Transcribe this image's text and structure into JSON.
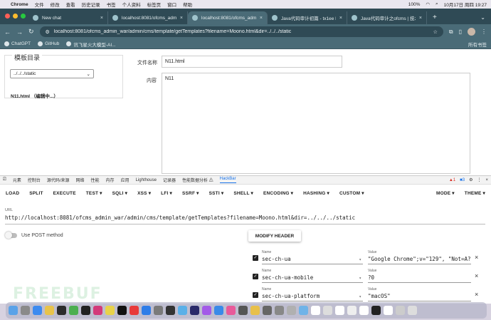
{
  "menubar": {
    "app": "Chrome",
    "items": [
      "文件",
      "修改",
      "查看",
      "历史记录",
      "书签",
      "个人资料",
      "标签页",
      "窗口",
      "帮助"
    ],
    "battery": "100%",
    "datetime": "10月17日 周四 19:27"
  },
  "tabs": [
    {
      "title": "New chat",
      "active": false
    },
    {
      "title": "localhost:8081/ofcms_admin",
      "active": false
    },
    {
      "title": "localhost:8081/ofcms_admin",
      "active": true
    },
    {
      "title": "Java代码审计初篇 - tx1ee blog",
      "active": false
    },
    {
      "title": "Java代码审计之ofcms | 技术…",
      "active": false
    }
  ],
  "toolbar": {
    "url": "localhost:8081/ofcms_admin_war/admin/cms/template/getTemplates?filename=Moono.html&dir=../../../static"
  },
  "bookmarks": {
    "items": [
      "ChatGPT",
      "GitHub",
      "讯飞星火大模型-AI..."
    ],
    "all": "所有书签"
  },
  "page": {
    "panel_title": "模板目录",
    "dir_select": "../../../static",
    "file_item": "N11.html （编辑中...）",
    "filename_label": "文件名称",
    "filename_value": "N11.html",
    "content_label": "内容",
    "content_value": "N11"
  },
  "devtools": {
    "tabs": [
      "元素",
      "控制台",
      "源代码/来源",
      "网络",
      "性能",
      "内存",
      "应用",
      "Lighthouse",
      "记录器",
      "性能数据分析 ⚠",
      "HackBar"
    ],
    "active_tab": "HackBar",
    "errors": "1",
    "infos": "3"
  },
  "hackbar": {
    "menu": [
      "LOAD",
      "SPLIT",
      "EXECUTE",
      "TEST ▾",
      "SQLI ▾",
      "XSS ▾",
      "LFI ▾",
      "SSRF ▾",
      "SSTI ▾",
      "SHELL ▾",
      "ENCODING ▾",
      "HASHING ▾",
      "CUSTOM ▾"
    ],
    "menu_right": [
      "MODE ▾",
      "THEME ▾"
    ],
    "url_label": "URL",
    "url_value": "http://localhost:8081/ofcms_admin_war/admin/cms/template/getTemplates?filename=Moono.html&dir=../../../static",
    "post_label": "Use POST method",
    "modify_header": "MODIFY HEADER",
    "headers": [
      {
        "name_label": "Name",
        "name": "sec-ch-ua",
        "value_label": "Value",
        "value": "\"Google Chrome\";v=\"129\", \"Not=A?"
      },
      {
        "name_label": "Name",
        "name": "sec-ch-ua-mobile",
        "value_label": "Value",
        "value": "?0"
      },
      {
        "name_label": "Name",
        "name": "sec-ch-ua-platform",
        "value_label": "Value",
        "value": "\"macOS\""
      }
    ]
  },
  "watermark": "FREEBUF",
  "colors": {
    "tabstrip": "#2f4a55",
    "toolbar": "#4a6b77",
    "accent": "#1a73e8"
  }
}
